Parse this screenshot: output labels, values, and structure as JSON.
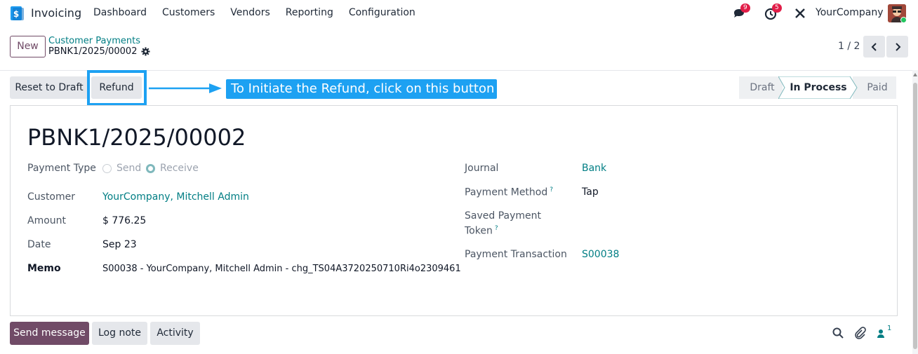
{
  "navbar": {
    "app_name": "Invoicing",
    "menu": [
      "Dashboard",
      "Customers",
      "Vendors",
      "Reporting",
      "Configuration"
    ],
    "messages_badge": "9",
    "activities_badge": "5",
    "company": "YourCompany"
  },
  "control_panel": {
    "new_label": "New",
    "breadcrumb": "Customer Payments",
    "record_name": "PBNK1/2025/00002",
    "pager": "1 / 2"
  },
  "actions": {
    "reset_label": "Reset to Draft",
    "refund_label": "Refund",
    "callout_text": "To Initiate the Refund, click on this button"
  },
  "status": {
    "stages": [
      "Draft",
      "In Process",
      "Paid"
    ],
    "active": "In Process"
  },
  "form": {
    "title": "PBNK1/2025/00002",
    "payment_type_label": "Payment Type",
    "payment_type_options": [
      "Send",
      "Receive"
    ],
    "payment_type_selected": "Receive",
    "customer_label": "Customer",
    "customer_value": "YourCompany, Mitchell Admin",
    "amount_label": "Amount",
    "amount_value": "$ 776.25",
    "date_label": "Date",
    "date_value": "Sep 23",
    "memo_label": "Memo",
    "memo_value": "S00038 - YourCompany, Mitchell Admin - chg_TS04A3720250710Ri4o2309461",
    "journal_label": "Journal",
    "journal_value": "Bank",
    "payment_method_label": "Payment Method",
    "payment_method_value": "Tap",
    "saved_token_label_1": "Saved Payment",
    "saved_token_label_2": "Token",
    "transaction_label": "Payment Transaction",
    "transaction_value": "S00038",
    "help_mark": "?"
  },
  "chatter": {
    "send_label": "Send message",
    "log_label": "Log note",
    "activity_label": "Activity",
    "followers_count": "1"
  },
  "colors": {
    "brand": "#714b67",
    "link": "#017e84",
    "callout": "#1da1f2"
  }
}
